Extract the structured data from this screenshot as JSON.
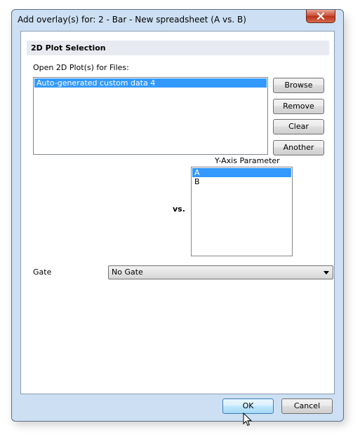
{
  "window": {
    "title": "Add overlay(s) for: 2 - Bar - New spreadsheet (A vs. B)"
  },
  "section": {
    "title": "2D Plot Selection"
  },
  "files": {
    "label": "Open 2D Plot(s) for Files:",
    "items": [
      "Auto-generated custom data 4"
    ]
  },
  "buttons": {
    "browse": "Browse",
    "remove": "Remove",
    "clear": "Clear",
    "another": "Another"
  },
  "y_axis": {
    "label": "Y-Axis Parameter",
    "items": [
      "A",
      "B"
    ]
  },
  "vs_label": "vs.",
  "gate": {
    "label": "Gate",
    "selected": "No Gate"
  },
  "footer": {
    "ok": "OK",
    "cancel": "Cancel"
  },
  "icons": {
    "close": "close-icon",
    "dropdown": "chevron-down-icon",
    "cursor": "mouse-pointer-icon"
  }
}
